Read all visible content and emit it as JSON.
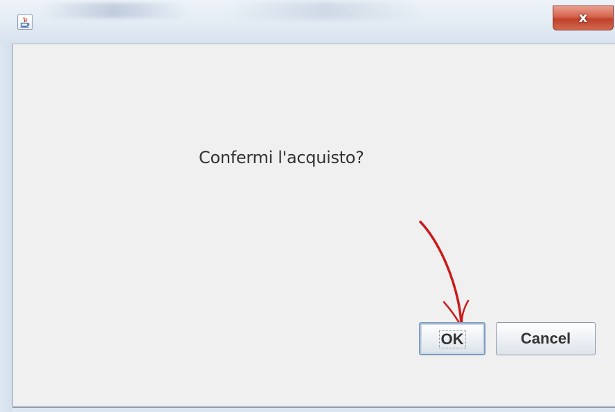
{
  "window": {
    "title": "",
    "close_label": "x"
  },
  "dialog": {
    "message": "Confermi l'acquisto?",
    "ok_label": "OK",
    "cancel_label": "Cancel"
  },
  "annotation": {
    "arrow_color": "#cc1a1a",
    "points_to": "ok-button"
  },
  "colors": {
    "dialog_background": "#f0f0f0",
    "close_button": "#c9432c"
  },
  "icons": {
    "app_icon": "java-icon",
    "close_icon": "close-icon"
  }
}
